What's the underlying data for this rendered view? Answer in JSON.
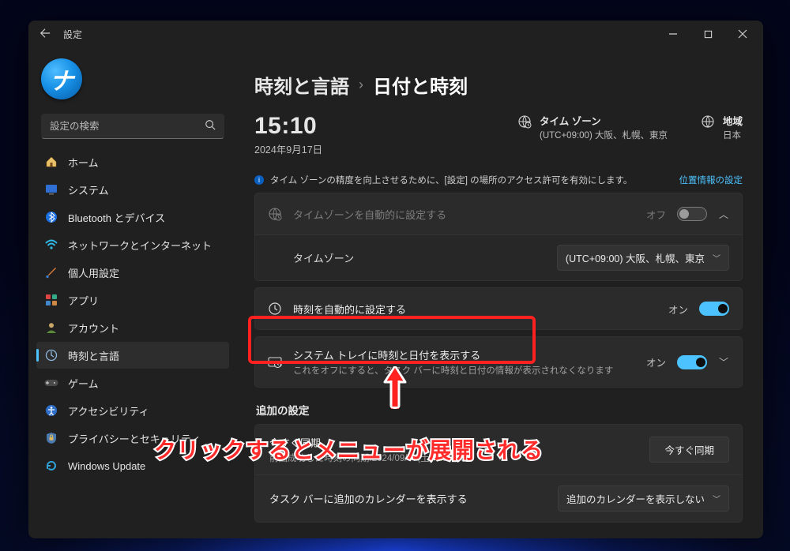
{
  "app_title": "設定",
  "avatar_letter": "ナ",
  "search": {
    "placeholder": "設定の検索"
  },
  "sidebar": {
    "items": [
      {
        "label": "ホーム"
      },
      {
        "label": "システム"
      },
      {
        "label": "Bluetooth とデバイス"
      },
      {
        "label": "ネットワークとインターネット"
      },
      {
        "label": "個人用設定"
      },
      {
        "label": "アプリ"
      },
      {
        "label": "アカウント"
      },
      {
        "label": "時刻と言語"
      },
      {
        "label": "ゲーム"
      },
      {
        "label": "アクセシビリティ"
      },
      {
        "label": "プライバシーとセキュリティ"
      },
      {
        "label": "Windows Update"
      }
    ]
  },
  "breadcrumb": {
    "parent": "時刻と言語",
    "child": "日付と時刻",
    "sep": "›"
  },
  "clock": {
    "time": "15:10",
    "date": "2024年9月17日"
  },
  "head": {
    "tz": {
      "title": "タイム ゾーン",
      "sub": "(UTC+09:00) 大阪、札幌、東京"
    },
    "region": {
      "title": "地域",
      "sub": "日本"
    }
  },
  "info": {
    "text": "タイム ゾーンの精度を向上させるために、[設定] の場所のアクセス許可を有効にします。",
    "link": "位置情報の設定"
  },
  "rows": {
    "auto_tz": {
      "title": "タイムゾーンを自動的に設定する",
      "state": "オフ"
    },
    "tz_label": "タイムゾーン",
    "tz_value": "(UTC+09:00) 大阪、札幌、東京",
    "auto_time": {
      "title": "時刻を自動的に設定する",
      "state": "オン"
    },
    "systray": {
      "title": "システム トレイに時刻と日付を表示する",
      "sub": "これをオフにすると、タスク バーに時刻と日付の情報が表示されなくなります",
      "state": "オン"
    }
  },
  "additional": {
    "heading": "追加の設定",
    "sync": {
      "title": "今すぐ同期",
      "sub": "前回成功した時刻の同期:2024/09/07(土) 8:58:16",
      "button": "今すぐ同期"
    },
    "extra_cal": {
      "label": "タスク バーに追加のカレンダーを表示する",
      "value": "追加のカレンダーを表示しない"
    }
  },
  "annotation": {
    "text": "クリックするとメニューが展開される"
  }
}
